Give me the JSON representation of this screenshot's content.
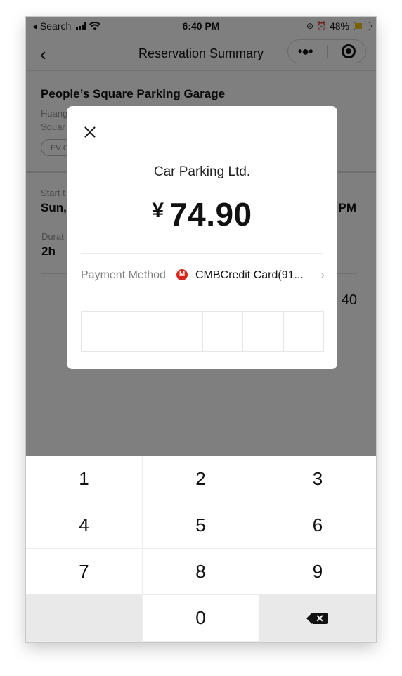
{
  "status_bar": {
    "back_app_label": "◂ Search",
    "time": "6:40 PM",
    "battery_percent": "48%",
    "battery_level": 0.48
  },
  "nav": {
    "title": "Reservation Summary"
  },
  "reservation": {
    "garage_name": "People’s Square Parking Garage",
    "address_line1": "Huang",
    "address_line2": "Squar",
    "tag": "EV C",
    "start_label": "Start t",
    "start_value": "Sun,",
    "end_value": "PM",
    "duration_label": "Durat",
    "duration_value": "2h",
    "price_value": "40"
  },
  "payment_modal": {
    "merchant": "Car Parking Ltd.",
    "currency_symbol": "¥",
    "amount": "74.90",
    "payment_method_label": "Payment Method",
    "payment_method_value": "CMBCredit Card(91...",
    "pin_length": 6
  },
  "keypad": {
    "keys": [
      "1",
      "2",
      "3",
      "4",
      "5",
      "6",
      "7",
      "8",
      "9",
      "",
      "0",
      "backspace"
    ]
  },
  "icons": {
    "back": "chevron-left-icon",
    "more": "more-dots-icon",
    "target": "target-icon",
    "close": "close-icon",
    "bank": "cmb-bank-icon",
    "chevron": "chevron-right-icon",
    "backspace": "backspace-icon"
  },
  "colors": {
    "bank_red": "#d7261e",
    "battery_yellow": "#f2c200",
    "overlay": "rgba(0,0,0,0.5)"
  }
}
